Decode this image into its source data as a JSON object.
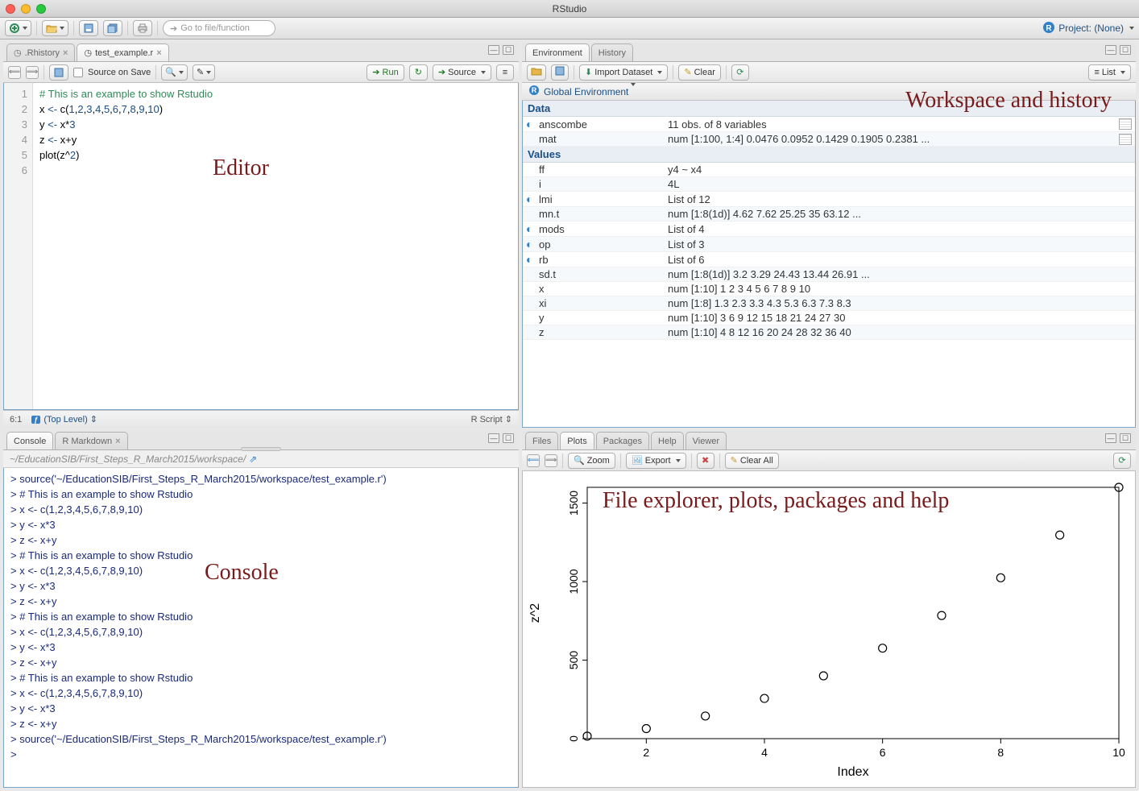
{
  "window": {
    "title": "RStudio"
  },
  "maintoolbar": {
    "goto_placeholder": "Go to file/function",
    "project_label": "Project: (None)"
  },
  "editor": {
    "tabs": [
      {
        "label": ".Rhistory",
        "active": false
      },
      {
        "label": "test_example.r",
        "active": true
      }
    ],
    "source_on_save": "Source on Save",
    "run_label": "Run",
    "source_label": "Source",
    "lines": [
      {
        "n": 1,
        "html": "<span class='cm-comment'># This is an example to show Rstudio</span>"
      },
      {
        "n": 2,
        "html": "x <span class='cm-op'>&lt;-</span> c(<span class='cm-num'>1</span>,<span class='cm-num'>2</span>,<span class='cm-num'>3</span>,<span class='cm-num'>4</span>,<span class='cm-num'>5</span>,<span class='cm-num'>6</span>,<span class='cm-num'>7</span>,<span class='cm-num'>8</span>,<span class='cm-num'>9</span>,<span class='cm-num'>10</span>)"
      },
      {
        "n": 3,
        "html": "y <span class='cm-op'>&lt;-</span> x*<span class='cm-num'>3</span>"
      },
      {
        "n": 4,
        "html": "z <span class='cm-op'>&lt;-</span> x+y"
      },
      {
        "n": 5,
        "html": "plot(z^<span class='cm-num'>2</span>)"
      },
      {
        "n": 6,
        "html": ""
      }
    ],
    "status_pos": "6:1",
    "status_scope": "(Top Level)",
    "status_lang": "R Script"
  },
  "console": {
    "tabs": [
      {
        "label": "Console",
        "active": true
      },
      {
        "label": "R Markdown",
        "active": false
      }
    ],
    "path": "~/EducationSIB/First_Steps_R_March2015/workspace/",
    "lines": [
      "> source('~/EducationSIB/First_Steps_R_March2015/workspace/test_example.r')",
      "> # This is an example to show Rstudio",
      "> x <- c(1,2,3,4,5,6,7,8,9,10)",
      "> y <- x*3",
      "> z <- x+y",
      "> # This is an example to show Rstudio",
      "> x <- c(1,2,3,4,5,6,7,8,9,10)",
      "> y <- x*3",
      "> z <- x+y",
      "> # This is an example to show Rstudio",
      "> x <- c(1,2,3,4,5,6,7,8,9,10)",
      "> y <- x*3",
      "> z <- x+y",
      "> # This is an example to show Rstudio",
      "> x <- c(1,2,3,4,5,6,7,8,9,10)",
      "> y <- x*3",
      "> z <- x+y",
      "> source('~/EducationSIB/First_Steps_R_March2015/workspace/test_example.r')",
      "> "
    ]
  },
  "env": {
    "tabs": [
      {
        "label": "Environment",
        "active": true
      },
      {
        "label": "History",
        "active": false
      }
    ],
    "import_label": "Import Dataset",
    "clear_label": "Clear",
    "list_label": "List",
    "scope_label": "Global Environment",
    "headers": {
      "data": "Data",
      "values": "Values"
    },
    "data_rows": [
      {
        "name": "anscombe",
        "value": "11 obs. of 8 variables",
        "expand": true,
        "grid": true
      },
      {
        "name": "mat",
        "value": "num [1:100, 1:4] 0.0476 0.0952 0.1429 0.1905 0.2381 ...",
        "expand": false,
        "grid": true
      }
    ],
    "value_rows": [
      {
        "name": "ff",
        "value": "y4 ~ x4",
        "expand": false
      },
      {
        "name": "i",
        "value": "4L",
        "expand": false
      },
      {
        "name": "lmi",
        "value": "List of 12",
        "expand": true
      },
      {
        "name": "mn.t",
        "value": "num [1:8(1d)] 4.62 7.62 25.25 35 63.12 ...",
        "expand": false
      },
      {
        "name": "mods",
        "value": "List of 4",
        "expand": true
      },
      {
        "name": "op",
        "value": "List of 3",
        "expand": true
      },
      {
        "name": "rb",
        "value": "List of 6",
        "expand": true
      },
      {
        "name": "sd.t",
        "value": "num [1:8(1d)] 3.2 3.29 24.43 13.44 26.91 ...",
        "expand": false
      },
      {
        "name": "x",
        "value": "num [1:10] 1 2 3 4 5 6 7 8 9 10",
        "expand": false
      },
      {
        "name": "xi",
        "value": "num [1:8] 1.3 2.3 3.3 4.3 5.3 6.3 7.3 8.3",
        "expand": false
      },
      {
        "name": "y",
        "value": "num [1:10] 3 6 9 12 15 18 21 24 27 30",
        "expand": false
      },
      {
        "name": "z",
        "value": "num [1:10] 4 8 12 16 20 24 28 32 36 40",
        "expand": false
      }
    ]
  },
  "plots": {
    "tabs": [
      "Files",
      "Plots",
      "Packages",
      "Help",
      "Viewer"
    ],
    "active_tab": 1,
    "zoom_label": "Zoom",
    "export_label": "Export",
    "clearall_label": "Clear All",
    "xlabel": "Index",
    "ylabel": "z^2"
  },
  "annotations": {
    "editor": "Editor",
    "workspace": "Workspace and history",
    "console": "Console",
    "files": "File explorer, plots, packages and help"
  },
  "chart_data": {
    "type": "scatter",
    "x": [
      1,
      2,
      3,
      4,
      5,
      6,
      7,
      8,
      9,
      10
    ],
    "y": [
      16,
      64,
      144,
      256,
      400,
      576,
      784,
      1024,
      1296,
      1600
    ],
    "xlabel": "Index",
    "ylabel": "z^2",
    "xlim": [
      1,
      10
    ],
    "ylim": [
      0,
      1600
    ],
    "xticks": [
      2,
      4,
      6,
      8,
      10
    ],
    "yticks": [
      0,
      500,
      1000,
      1500
    ]
  }
}
